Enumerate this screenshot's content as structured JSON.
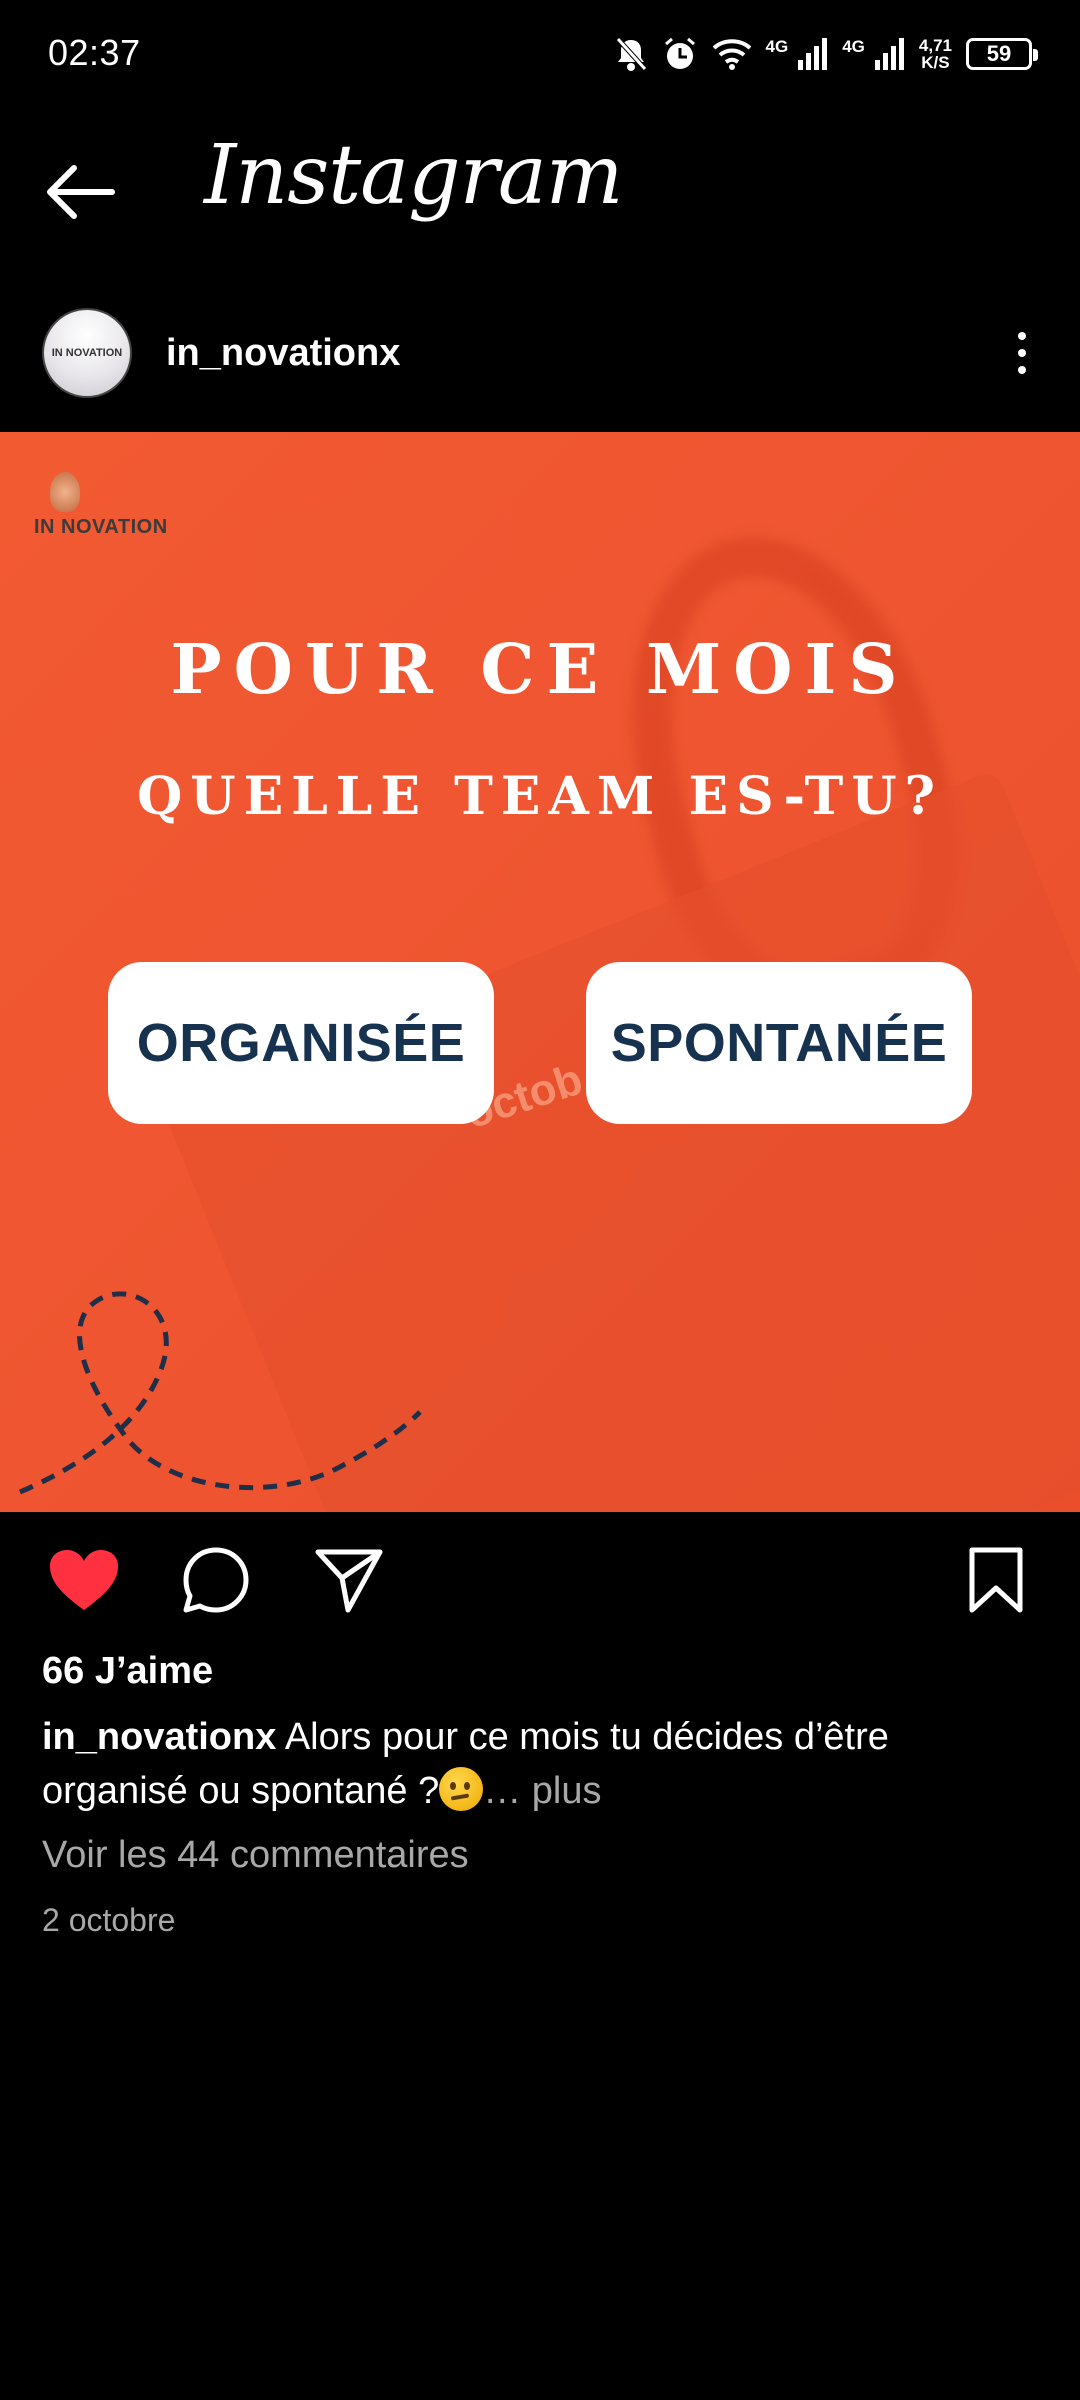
{
  "status_bar": {
    "time": "02:37",
    "network_1": "4G",
    "network_2": "4G",
    "speed_value": "4,71",
    "speed_unit": "K/S",
    "battery": "59"
  },
  "header": {
    "title": "Instagram"
  },
  "post": {
    "username": "in_novationx",
    "avatar_label": "IN NOVATION",
    "image": {
      "brand": "IN NOVATION",
      "headline_1": "POUR CE MOIS",
      "headline_2": "QUELLE TEAM ES-TU?",
      "option_1": "ORGANISÉE",
      "option_2": "SPONTANÉE",
      "calendar_word": "octob",
      "background_color": "#f05431",
      "button_text_color": "#17324f"
    },
    "liked": true,
    "like_color": "#ff3040",
    "likes_text": "66 J’aime",
    "caption_user": "in_novationx",
    "caption_text": " Alors pour ce mois tu décides d’être organisé ou spontané ?",
    "caption_emoji": "thinking-face-emoji",
    "caption_more": "… plus",
    "comments_link": "Voir les 44 commentaires",
    "date": "2 octobre"
  },
  "icons": {
    "back": "arrow-left-icon",
    "more": "more-vertical-icon",
    "like": "heart-filled-icon",
    "comment": "comment-icon",
    "share": "paper-plane-icon",
    "save": "bookmark-icon"
  }
}
